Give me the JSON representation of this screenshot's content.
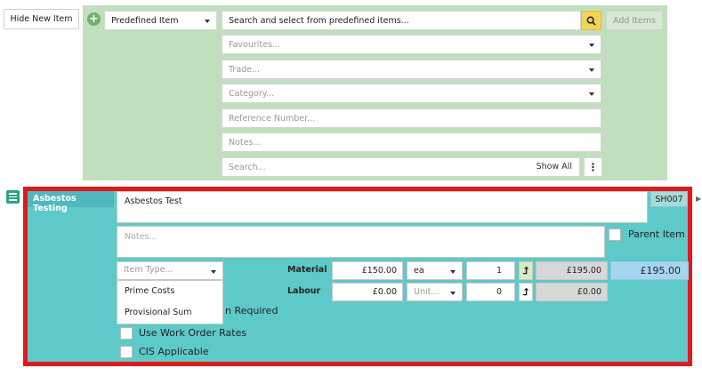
{
  "toolbar": {
    "hide_new_item": "Hide New Item",
    "item_source": "Predefined Item",
    "search_placeholder": "Search and select from predefined items...",
    "add_items": "Add Items"
  },
  "filters": {
    "favourites": "Favourites...",
    "trade": "Trade...",
    "category": "Category...",
    "reference": "Reference Number...",
    "notes": "Notes...",
    "search": "Search...",
    "show_all": "Show All"
  },
  "line_item": {
    "header": "Asbestos Testing",
    "name": "Asbestos Test",
    "code": "SH007",
    "notes_placeholder": "Notes...",
    "parent_item_label": "Parent Item",
    "item_type_placeholder": "Item Type...",
    "item_type_options": [
      "Prime Costs",
      "Provisional Sum"
    ],
    "partial_label_hidden": "n Required",
    "material": {
      "label": "Material",
      "price": "£150.00",
      "unit": "ea",
      "qty": "1",
      "total": "£195.00"
    },
    "labour": {
      "label": "Labour",
      "price": "£0.00",
      "unit_placeholder": "Unit...",
      "qty": "0",
      "total": "£0.00"
    },
    "grand_total": "£195.00",
    "work_order_rates": "Use Work Order Rates",
    "cis_applicable": "CIS Applicable"
  },
  "colors": {
    "green_panel": "#c1dfbe",
    "teal": "#5ec9c9",
    "red_border": "#e0191b",
    "search_yellow": "#f1d35a",
    "total_blue": "#a6d6ef"
  }
}
